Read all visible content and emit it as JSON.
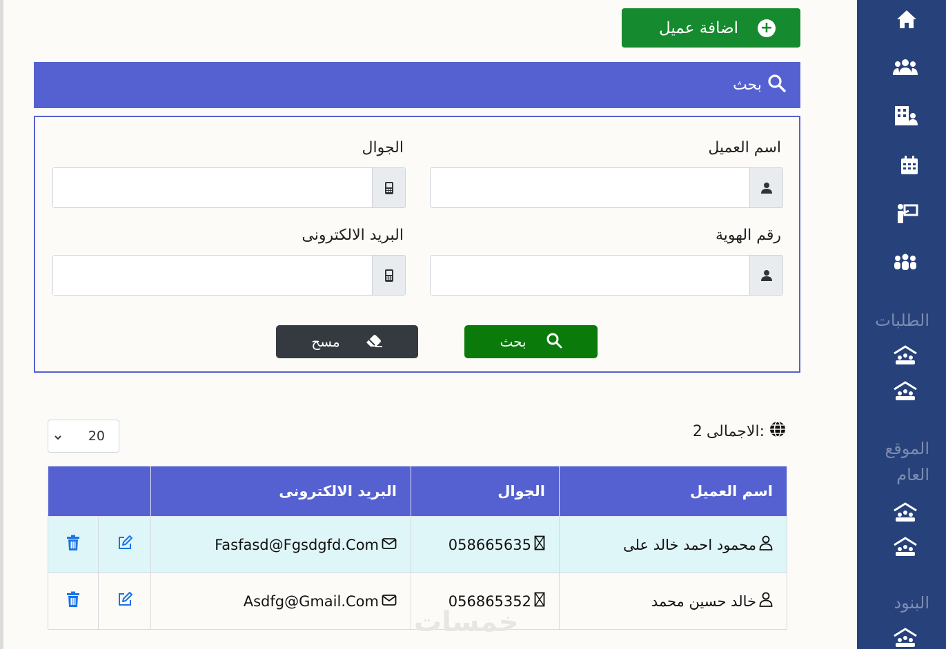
{
  "header": {
    "add_customer_label": "اضافة عميل"
  },
  "search": {
    "title": "بحث",
    "fields": {
      "customer_name_label": "اسم العميل",
      "mobile_label": "الجوال",
      "id_number_label": "رقم الهوية",
      "email_label": "البريد الالكترونى"
    },
    "search_button": "بحث",
    "clear_button": "مسح"
  },
  "summary": {
    "total_label": "الاجمالى:",
    "total_value": "2",
    "page_size": "20"
  },
  "table": {
    "columns": [
      "اسم العميل",
      "الجوال",
      "البريد الالكترونى",
      ""
    ],
    "rows": [
      {
        "name": "محمود احمد خالد على",
        "mobile": "058665635",
        "email": "Fasfasd@Fgsdgfd.Com"
      },
      {
        "name": "خالد حسين محمد",
        "mobile": "056865352",
        "email": "Asdfg@Gmail.Com"
      }
    ]
  },
  "sidebar": {
    "sections": [
      "الطلبات",
      "الموقع العام",
      "البنود"
    ]
  },
  "watermark": "خمسات",
  "colors": {
    "sidebar": "#27417b",
    "accent": "#5561d0",
    "success": "#168a2e",
    "dark": "#353a40",
    "row_highlight": "#dff6f8",
    "action_icon": "#1a73e8"
  }
}
